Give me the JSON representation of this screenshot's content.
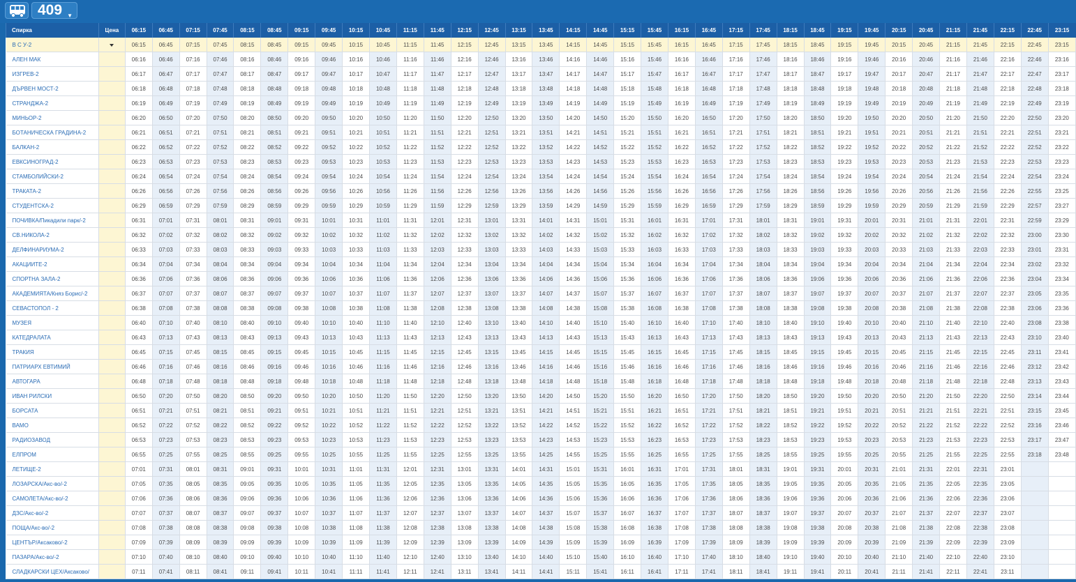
{
  "header": {
    "route_number": "409",
    "bus_icon": "bus-icon"
  },
  "table": {
    "stop_header": "Спирка",
    "price_header": "Цена",
    "trips": [
      "06:15",
      "06:45",
      "07:15",
      "07:45",
      "08:15",
      "08:45",
      "09:15",
      "09:45",
      "10:15",
      "10:45",
      "11:15",
      "11:45",
      "12:15",
      "12:45",
      "13:15",
      "13:45",
      "14:15",
      "14:45",
      "15:15",
      "15:45",
      "16:15",
      "16:45",
      "17:15",
      "17:45",
      "18:15",
      "18:45",
      "19:15",
      "19:45",
      "20:15",
      "20:45",
      "21:15",
      "21:45",
      "22:15",
      "22:45",
      "23:15"
    ],
    "stops": [
      {
        "name": "В С У-2",
        "first": "06:15",
        "offsets": [],
        "skip_last": 0
      },
      {
        "name": "АЛЕН МАК",
        "first": "06:16",
        "skip_last": 0
      },
      {
        "name": "ИЗГРЕВ-2",
        "first": "06:17",
        "skip_last": 0
      },
      {
        "name": "ДЪРВЕН МОСТ-2",
        "first": "06:18",
        "skip_last": 0
      },
      {
        "name": "СТРАНДЖА-2",
        "first": "06:19",
        "skip_last": 0
      },
      {
        "name": "МИНЬОР-2",
        "first": "06:20",
        "skip_last": 0
      },
      {
        "name": "БОТАНИЧЕСКА ГРАДИНА-2",
        "first": "06:21",
        "skip_last": 0
      },
      {
        "name": "БАЛКАН-2",
        "first": "06:22",
        "skip_last": 0
      },
      {
        "name": "ЕВКСИНОГРАД-2",
        "first": "06:23",
        "skip_last": 0
      },
      {
        "name": "СТАМБОЛИЙСКИ-2",
        "first": "06:24",
        "skip_last": 0
      },
      {
        "name": "ТРАКАТА-2",
        "first": "06:26",
        "skip_last": 0
      },
      {
        "name": "СТУДЕНТСКА-2",
        "first": "06:29",
        "skip_last": 0
      },
      {
        "name": "ПОЧИВКА/Пикадили парк/-2",
        "first": "06:31",
        "skip_last": 0
      },
      {
        "name": "СВ.НИКОЛА-2",
        "first": "06:32",
        "skip_last": 0
      },
      {
        "name": "ДЕЛФИНАРИУМА-2",
        "first": "06:33",
        "skip_last": 0
      },
      {
        "name": "АКАЦИИТЕ-2",
        "first": "06:34",
        "skip_last": 0
      },
      {
        "name": "СПОРТНА ЗАЛА-2",
        "first": "06:36",
        "skip_last": 0
      },
      {
        "name": "АКАДЕМИЯТА/Княз Борис/-2",
        "first": "06:37",
        "skip_last": 0
      },
      {
        "name": "СЕВАСТОПОЛ - 2",
        "first": "06:38",
        "skip_last": 0
      },
      {
        "name": "МУЗЕЯ",
        "first": "06:40",
        "skip_last": 0
      },
      {
        "name": "КАТЕДРАЛАТА",
        "first": "06:43",
        "skip_last": 0
      },
      {
        "name": "ТРАКИЯ",
        "first": "06:45",
        "skip_last": 0
      },
      {
        "name": "ПАТРИАРХ ЕВТИМИЙ",
        "first": "06:46",
        "skip_last": 0
      },
      {
        "name": "АВТОГАРА",
        "first": "06:48",
        "skip_last": 0
      },
      {
        "name": "ИВАН РИЛСКИ",
        "first": "06:50",
        "skip_last": 0
      },
      {
        "name": "БОРСАТА",
        "first": "06:51",
        "skip_last": 0
      },
      {
        "name": "ВАМО",
        "first": "06:52",
        "skip_last": 0
      },
      {
        "name": "РАДИОЗАВОД",
        "first": "06:53",
        "skip_last": 0
      },
      {
        "name": "ЕЛПРОМ",
        "first": "06:55",
        "skip_last": 0
      },
      {
        "name": "ЛЕТИЩЕ-2",
        "first": "07:01",
        "skip_last": 2
      },
      {
        "name": "ЛОЗАРСКА/Акс-во/-2",
        "first": "07:05",
        "skip_last": 2
      },
      {
        "name": "САМОЛЕТА/Акс-во/-2",
        "first": "07:06",
        "skip_last": 2
      },
      {
        "name": "ДЗС/Акс-во/-2",
        "first": "07:07",
        "skip_last": 2
      },
      {
        "name": "ПОЩА/Акс-во/-2",
        "first": "07:08",
        "skip_last": 2
      },
      {
        "name": "ЦЕНТЪР/Аксаково/-2",
        "first": "07:09",
        "skip_last": 2
      },
      {
        "name": "ПАЗАРА/Акс-во/-2",
        "first": "07:10",
        "skip_last": 2
      },
      {
        "name": "СЛАДКАРСКИ ЦЕХ/Аксаково/",
        "first": "07:11",
        "skip_last": 2
      }
    ],
    "late_overrides": {
      "В С У-2": [
        "22:45",
        "23:15"
      ],
      "АЛЕН МАК": [
        "22:46",
        "23:16"
      ],
      "ИЗГРЕВ-2": [
        "22:47",
        "23:17"
      ],
      "ДЪРВЕН МОСТ-2": [
        "22:48",
        "23:18"
      ],
      "СТРАНДЖА-2": [
        "22:49",
        "23:19"
      ],
      "МИНЬОР-2": [
        "22:50",
        "23:20"
      ],
      "БОТАНИЧЕСКА ГРАДИНА-2": [
        "22:51",
        "23:21"
      ],
      "БАЛКАН-2": [
        "22:52",
        "23:22"
      ],
      "ЕВКСИНОГРАД-2": [
        "22:53",
        "23:23"
      ],
      "СТАМБОЛИЙСКИ-2": [
        "22:54",
        "23:24"
      ],
      "ТРАКАТА-2": [
        "22:55",
        "23:25"
      ],
      "СТУДЕНТСКА-2": [
        "22:57",
        "23:27"
      ],
      "ПОЧИВКА/Пикадили парк/-2": [
        "22:59",
        "23:29"
      ],
      "СВ.НИКОЛА-2": [
        "23:00",
        "23:30"
      ],
      "ДЕЛФИНАРИУМА-2": [
        "23:01",
        "23:31"
      ],
      "АКАЦИИТЕ-2": [
        "23:02",
        "23:32"
      ],
      "СПОРТНА ЗАЛА-2": [
        "23:04",
        "23:34"
      ],
      "АКАДЕМИЯТА/Княз Борис/-2": [
        "23:05",
        "23:35"
      ],
      "СЕВАСТОПОЛ - 2": [
        "23:06",
        "23:36"
      ],
      "МУЗЕЯ": [
        "23:08",
        "23:38"
      ],
      "КАТЕДРАЛАТА": [
        "23:10",
        "23:40"
      ],
      "ТРАКИЯ": [
        "23:11",
        "23:41"
      ],
      "ПАТРИАРХ ЕВТИМИЙ": [
        "23:12",
        "23:42"
      ],
      "АВТОГАРА": [
        "23:13",
        "23:43"
      ],
      "ИВАН РИЛСКИ": [
        "23:14",
        "23:44"
      ],
      "БОРСАТА": [
        "23:15",
        "23:45"
      ],
      "ВАМО": [
        "23:16",
        "23:46"
      ],
      "РАДИОЗАВОД": [
        "23:17",
        "23:47"
      ],
      "ЕЛПРОМ": [
        "23:18",
        "23:48"
      ]
    },
    "selected_stop_index": 0
  }
}
